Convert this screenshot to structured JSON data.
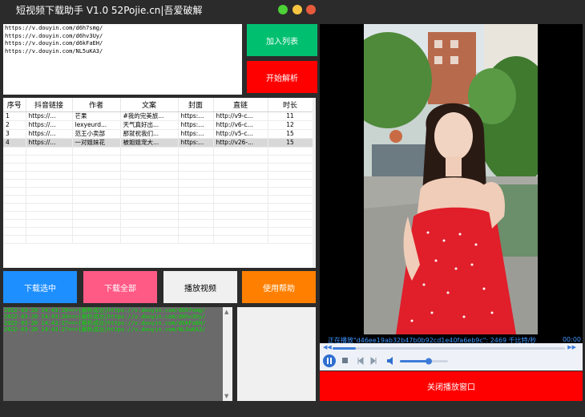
{
  "window": {
    "title": "短视频下载助手 V1.0    52Pojie.cn|吾爱破解",
    "controls": {
      "green": "#4cd137",
      "yellow": "#f5c542",
      "red": "#e65a3c"
    }
  },
  "url_input": {
    "lines": [
      "https://v.douyin.com/d6h7smg/",
      "https://v.douyin.com/d6hv3Uy/",
      "https://v.douyin.com/d6kFaEH/",
      "https://v.douyin.com/NL5uKA3/"
    ]
  },
  "buttons": {
    "add_to_list": {
      "label": "加入列表",
      "color": "#00c070"
    },
    "start_parse": {
      "label": "开始解析",
      "color": "#ff0000"
    },
    "download_selected": {
      "label": "下载选中",
      "color": "#1e8fff"
    },
    "download_all": {
      "label": "下载全部",
      "color": "#ff5a86"
    },
    "play_video": {
      "label": "播放视频",
      "color": "#f0f0f0"
    },
    "help": {
      "label": "使用帮助",
      "color": "#ff8000"
    }
  },
  "table": {
    "columns": [
      "序号",
      "抖音链接",
      "作者",
      "文案",
      "封面",
      "直链",
      "时长"
    ],
    "rows": [
      [
        "1",
        "https://...",
        "芒果",
        "#我的完美旅...",
        "https:...",
        "http://v9-c...",
        "11"
      ],
      [
        "2",
        "https://...",
        "lexyeurd...",
        "天气真好出...",
        "https:...",
        "http://v6-c...",
        "12"
      ],
      [
        "3",
        "https://...",
        "范王小卖部",
        "那就祝我们...",
        "https:...",
        "http://v5-c...",
        "15"
      ],
      [
        "4",
        "https://...",
        "一对姐妹花",
        "被姐姐宠大...",
        "https:...",
        "http://v26-...",
        "15"
      ]
    ]
  },
  "log": {
    "lines": [
      "2022-03-20 14:43:26==>[解析成功]https://v.douyin.com/d6h7smg/",
      "2022-03-20 14:43:26==>[解析成功]https://v.douyin.com/d6hv3Uy/",
      "2022-03-20 14:43:27==>[解析成功]https://v.douyin.com/d6kFaEH/",
      "2022-03-20 14:43:27==>[解析成功]https://v.douyin.com/NL5uKA3/"
    ]
  },
  "player": {
    "status": "正在播放\"d46ee19ab32b47b0b92cd1e40fa6eb9c\": 2469 千比特/秒",
    "time": "00:00",
    "seek_progress": 0.1,
    "volume": 0.6,
    "close_label": "关闭播放窗口"
  }
}
